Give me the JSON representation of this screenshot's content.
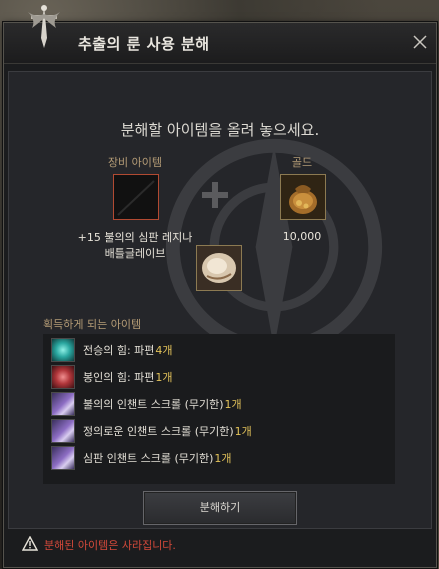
{
  "window": {
    "title": "추출의 룬 사용 분해",
    "close_icon": "close-icon"
  },
  "main": {
    "instruction": "분해할 아이템을 올려 놓으세요.",
    "equipment": {
      "label": "장비 아이템",
      "item_name_line1": "+15 불의의 심판 레지나",
      "item_name_line2": "배틀글레이브"
    },
    "gold": {
      "label": "골드",
      "amount": "10,000"
    }
  },
  "rewards": {
    "title": "획득하게 되는 아이템",
    "items": [
      {
        "name": "전승의 힘: 파편 ",
        "count": "4개",
        "icon": "teal-shard-icon",
        "color": "#2aa7a0"
      },
      {
        "name": "봉인의 힘: 파편 ",
        "count": "1개",
        "icon": "red-shard-icon",
        "color": "#b0363a"
      },
      {
        "name": "불의의 인챈트 스크롤 (무기한) ",
        "count": "1개",
        "icon": "scroll-icon",
        "color": "#8d6ec4"
      },
      {
        "name": "정의로운 인챈트 스크롤 (무기한) ",
        "count": "1개",
        "icon": "scroll-icon",
        "color": "#8d6ec4"
      },
      {
        "name": "심판 인챈트 스크롤 (무기한) ",
        "count": "1개",
        "icon": "scroll-icon",
        "color": "#8d6ec4"
      }
    ]
  },
  "footer": {
    "button_label": "분해하기",
    "warning": "분해된 아이템은 사라집니다."
  },
  "colors": {
    "accent_warning": "#d4493a",
    "label_gold": "#b59c76",
    "count_yellow": "#e2c25a"
  }
}
